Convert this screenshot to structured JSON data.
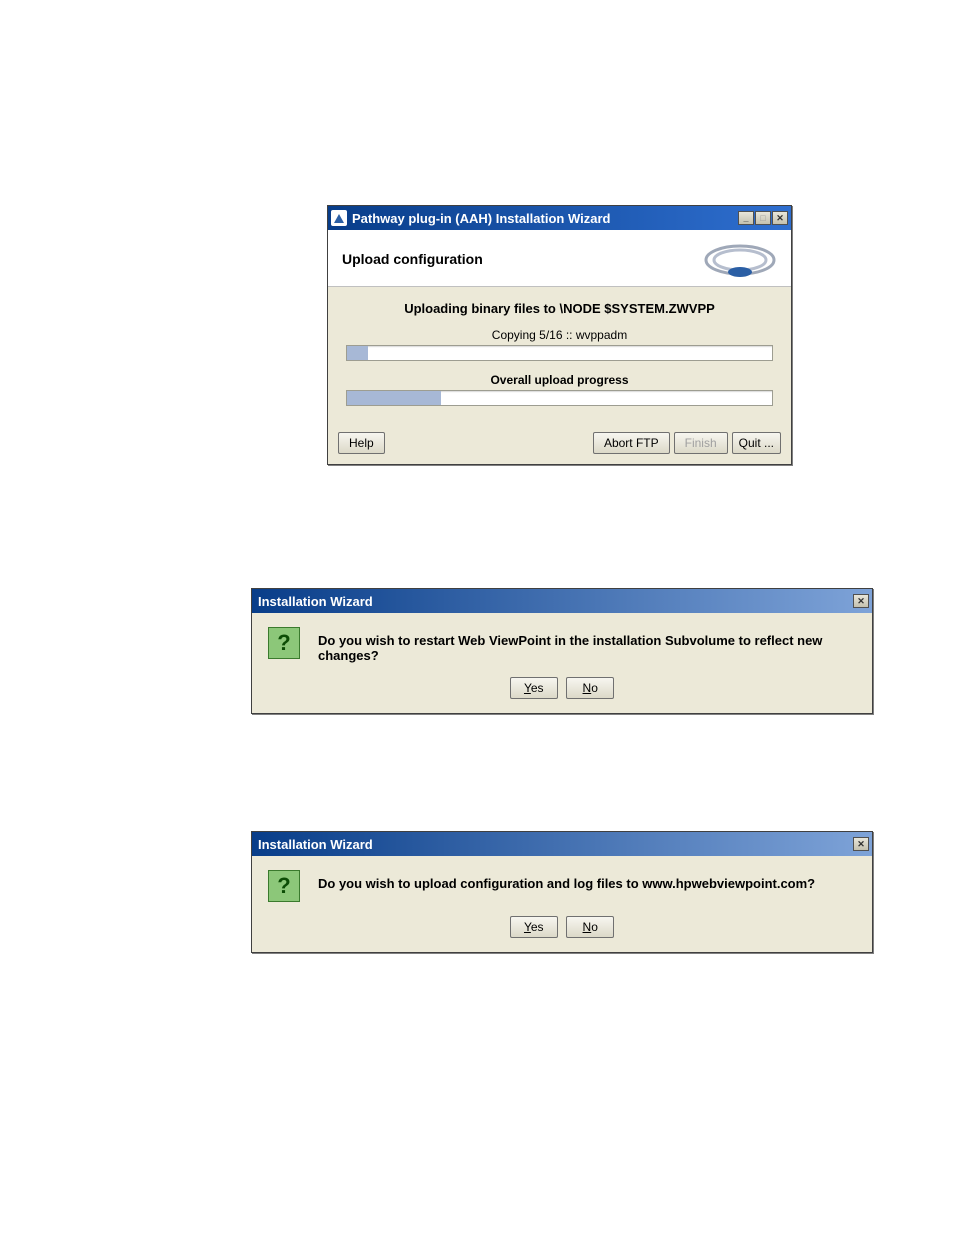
{
  "window1": {
    "title": "Pathway plug-in (AAH) Installation Wizard",
    "heading": "Upload configuration",
    "upload_line_prefix": "Uploading binary files to ",
    "upload_line_target": "\\NODE $SYSTEM.ZWVPP",
    "copying_line": "Copying 5/16 :: wvppadm",
    "overall_label": "Overall upload progress",
    "progress_file_percent": 5,
    "progress_overall_percent": 22,
    "buttons": {
      "help": "Help",
      "abort": "Abort FTP",
      "finish": "Finish",
      "quit": "Quit ..."
    }
  },
  "dialog2": {
    "title": "Installation Wizard",
    "message": "Do you wish to restart Web ViewPoint in the installation Subvolume to reflect new changes?",
    "yes": "Yes",
    "no": "No"
  },
  "dialog3": {
    "title": "Installation Wizard",
    "message": "Do you wish to upload configuration and log files to www.hpwebviewpoint.com?",
    "yes": "Yes",
    "no": "No"
  }
}
